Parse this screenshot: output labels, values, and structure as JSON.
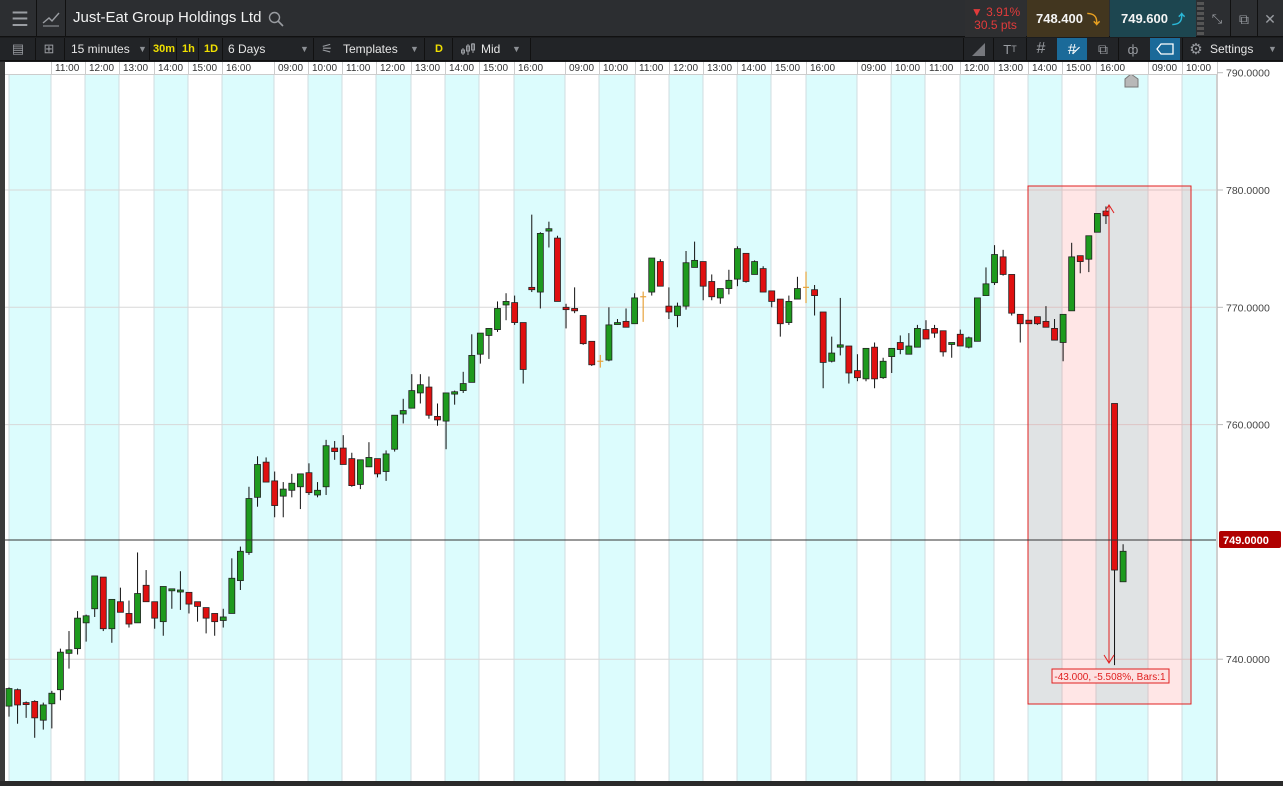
{
  "header": {
    "title": "Just-Eat Group Holdings Ltd",
    "change_pct": "▼ 3.91%",
    "change_pts": "30.5 pts",
    "sell_price": "748.400",
    "buy_price": "749.600"
  },
  "toolbar": {
    "interval": "15 minutes",
    "quick_intervals": [
      "30m",
      "1h",
      "1D"
    ],
    "range": "6 Days",
    "templates": "Templates",
    "d_label": "D",
    "price_type": "Mid",
    "settings": "Settings"
  },
  "time_axis": [
    "11:00",
    "12:00",
    "13:00",
    "14:00",
    "15:00",
    "16:00",
    "09:00",
    "10:00",
    "11:00",
    "12:00",
    "13:00",
    "14:00",
    "15:00",
    "16:00",
    "09:00",
    "10:00",
    "11:00",
    "12:00",
    "13:00",
    "14:00",
    "15:00",
    "16:00",
    "09:00",
    "10:00",
    "11:00",
    "12:00",
    "13:00",
    "14:00",
    "15:00",
    "16:00",
    "09:00",
    "10:00"
  ],
  "price_axis": {
    "ticks": [
      "790.0000",
      "780.0000",
      "770.0000",
      "760.0000",
      "740.0000"
    ],
    "current_price": "749.0000"
  },
  "measure": {
    "label": "-43.000, -5.508%, Bars:1"
  },
  "colors": {
    "up": "#1e9a1e",
    "down": "#e01010",
    "doji": "#e8a33d",
    "current": "#b00000",
    "measure": "#e02020"
  },
  "chart_data": {
    "type": "candlestick",
    "interval": "15 minutes",
    "ylim": [
      735,
      790
    ],
    "y_ticks": [
      790,
      780,
      770,
      760,
      740
    ],
    "current_price": 749.0,
    "doji_orange_indices": [
      69,
      74,
      93
    ],
    "ohlc": [
      [
        736.0,
        737.6,
        735.1,
        737.5
      ],
      [
        737.4,
        737.5,
        734.5,
        736.1
      ],
      [
        736.3,
        736.4,
        735.0,
        736.2
      ],
      [
        736.4,
        736.5,
        733.3,
        735.0
      ],
      [
        734.8,
        736.3,
        734.0,
        736.1
      ],
      [
        736.2,
        737.3,
        734.1,
        737.1
      ],
      [
        737.4,
        740.9,
        736.5,
        740.6
      ],
      [
        740.5,
        742.4,
        739.2,
        740.8
      ],
      [
        740.9,
        744.1,
        740.4,
        743.5
      ],
      [
        743.1,
        743.8,
        741.5,
        743.7
      ],
      [
        744.3,
        747.1,
        743.6,
        747.1
      ],
      [
        747.0,
        747.0,
        742.4,
        742.6
      ],
      [
        742.6,
        745.1,
        741.4,
        745.1
      ],
      [
        744.9,
        746.1,
        744.0,
        744.0
      ],
      [
        743.9,
        745.0,
        742.7,
        743.0
      ],
      [
        743.1,
        749.1,
        743.1,
        745.6
      ],
      [
        746.3,
        747.6,
        744.9,
        744.9
      ],
      [
        744.9,
        744.9,
        742.6,
        743.5
      ],
      [
        743.2,
        746.2,
        742.0,
        746.2
      ],
      [
        745.9,
        745.9,
        744.3,
        746.0
      ],
      [
        745.8,
        747.5,
        744.2,
        745.9
      ],
      [
        745.7,
        745.7,
        743.9,
        744.7
      ],
      [
        744.9,
        744.9,
        743.2,
        744.5
      ],
      [
        744.4,
        744.4,
        742.2,
        743.5
      ],
      [
        743.9,
        743.9,
        742.0,
        743.2
      ],
      [
        743.3,
        744.3,
        742.7,
        743.6
      ],
      [
        743.9,
        748.6,
        743.9,
        746.9
      ],
      [
        746.7,
        749.6,
        745.9,
        749.2
      ],
      [
        749.1,
        754.7,
        748.9,
        753.7
      ],
      [
        753.8,
        757.3,
        753.0,
        756.6
      ],
      [
        756.8,
        757.2,
        755.1,
        755.1
      ],
      [
        755.2,
        756.0,
        752.1,
        753.1
      ],
      [
        753.9,
        755.1,
        752.1,
        754.5
      ],
      [
        754.4,
        755.8,
        753.8,
        755.0
      ],
      [
        754.7,
        755.8,
        752.8,
        755.8
      ],
      [
        755.9,
        756.7,
        754.0,
        754.2
      ],
      [
        754.0,
        755.1,
        753.8,
        754.4
      ],
      [
        754.7,
        758.7,
        754.0,
        758.2
      ],
      [
        758.0,
        758.6,
        757.0,
        757.7
      ],
      [
        758.0,
        759.1,
        756.6,
        756.6
      ],
      [
        757.1,
        757.6,
        754.7,
        754.8
      ],
      [
        754.9,
        757.0,
        754.5,
        757.0
      ],
      [
        756.4,
        758.5,
        756.4,
        757.2
      ],
      [
        757.1,
        757.1,
        755.5,
        755.8
      ],
      [
        756.0,
        757.8,
        755.2,
        757.5
      ],
      [
        757.9,
        760.8,
        757.7,
        760.8
      ],
      [
        760.9,
        762.2,
        760.1,
        761.2
      ],
      [
        761.4,
        764.3,
        761.4,
        762.9
      ],
      [
        762.7,
        764.3,
        761.8,
        763.4
      ],
      [
        763.2,
        764.1,
        760.5,
        760.8
      ],
      [
        760.7,
        761.8,
        759.9,
        760.4
      ],
      [
        760.3,
        762.7,
        757.9,
        762.7
      ],
      [
        762.6,
        762.9,
        761.7,
        762.8
      ],
      [
        762.9,
        764.5,
        762.7,
        763.5
      ],
      [
        763.6,
        767.7,
        763.6,
        765.9
      ],
      [
        766.0,
        767.8,
        765.2,
        767.8
      ],
      [
        767.6,
        768.2,
        765.6,
        768.2
      ],
      [
        768.1,
        770.5,
        767.9,
        769.9
      ],
      [
        770.2,
        771.2,
        768.9,
        770.5
      ],
      [
        770.4,
        771.0,
        768.5,
        768.7
      ],
      [
        768.7,
        768.7,
        763.5,
        764.7
      ],
      [
        771.7,
        777.9,
        771.3,
        771.5
      ],
      [
        771.3,
        776.4,
        769.9,
        776.3
      ],
      [
        776.5,
        777.3,
        775.1,
        776.7
      ],
      [
        775.9,
        776.1,
        770.5,
        770.5
      ],
      [
        770.0,
        770.3,
        768.2,
        769.8
      ],
      [
        769.9,
        771.7,
        769.5,
        769.7
      ],
      [
        769.3,
        769.3,
        766.8,
        766.9
      ],
      [
        767.1,
        767.1,
        765.0,
        765.1
      ],
      [
        765.4,
        765.6,
        765.2,
        765.4
      ],
      [
        765.5,
        770.0,
        765.4,
        768.5
      ],
      [
        768.6,
        769.0,
        768.6,
        768.7
      ],
      [
        768.8,
        769.9,
        768.3,
        768.3
      ],
      [
        768.6,
        771.2,
        768.6,
        770.8
      ],
      [
        770.9,
        771.0,
        769.1,
        770.9
      ],
      [
        771.3,
        774.2,
        771.0,
        774.2
      ],
      [
        773.9,
        774.1,
        771.8,
        771.8
      ],
      [
        770.1,
        771.7,
        769.0,
        769.6
      ],
      [
        769.3,
        770.4,
        768.3,
        770.1
      ],
      [
        770.1,
        774.8,
        769.8,
        773.8
      ],
      [
        773.4,
        775.6,
        773.4,
        774.0
      ],
      [
        773.9,
        773.9,
        770.6,
        771.8
      ],
      [
        772.2,
        772.8,
        770.6,
        770.9
      ],
      [
        770.8,
        771.6,
        770.3,
        771.6
      ],
      [
        771.6,
        773.2,
        771.1,
        772.3
      ],
      [
        772.4,
        775.2,
        771.8,
        775.0
      ],
      [
        774.6,
        774.6,
        772.1,
        772.2
      ],
      [
        772.8,
        774.0,
        772.8,
        773.9
      ],
      [
        773.3,
        773.5,
        771.3,
        771.3
      ],
      [
        771.4,
        771.4,
        770.0,
        770.5
      ],
      [
        770.7,
        770.7,
        767.5,
        768.6
      ],
      [
        768.7,
        771.0,
        768.5,
        770.5
      ],
      [
        770.7,
        772.6,
        770.7,
        771.6
      ],
      [
        771.7,
        772.7,
        770.7,
        771.7
      ],
      [
        771.5,
        771.9,
        769.3,
        771.0
      ],
      [
        769.6,
        769.6,
        763.1,
        765.3
      ],
      [
        765.4,
        767.5,
        765.3,
        766.1
      ],
      [
        766.6,
        770.8,
        765.9,
        766.8
      ],
      [
        766.7,
        766.7,
        763.5,
        764.4
      ],
      [
        764.6,
        766.0,
        763.7,
        764.0
      ],
      [
        763.9,
        766.5,
        763.7,
        766.5
      ],
      [
        766.6,
        767.0,
        763.1,
        763.9
      ],
      [
        764.0,
        765.7,
        763.9,
        765.4
      ],
      [
        765.8,
        766.5,
        764.4,
        766.5
      ],
      [
        767.0,
        767.6,
        766.0,
        766.4
      ],
      [
        766.0,
        767.8,
        766.0,
        766.7
      ],
      [
        766.6,
        768.5,
        766.6,
        768.2
      ],
      [
        768.1,
        768.9,
        767.3,
        767.3
      ],
      [
        768.2,
        768.5,
        767.4,
        767.8
      ],
      [
        768.0,
        768.0,
        765.8,
        766.2
      ],
      [
        767.0,
        767.0,
        765.7,
        767.0
      ],
      [
        767.7,
        768.1,
        766.7,
        766.7
      ],
      [
        766.6,
        767.5,
        766.5,
        767.4
      ],
      [
        767.1,
        770.8,
        767.1,
        770.8
      ],
      [
        771.0,
        773.4,
        771.0,
        772.0
      ],
      [
        772.1,
        775.3,
        771.9,
        774.5
      ],
      [
        774.3,
        774.9,
        772.7,
        772.8
      ],
      [
        772.8,
        772.8,
        769.3,
        769.5
      ],
      [
        769.4,
        769.4,
        767.0,
        768.6
      ],
      [
        768.9,
        768.9,
        768.6,
        768.6
      ],
      [
        769.2,
        769.2,
        768.5,
        768.6
      ],
      [
        768.8,
        770.1,
        768.3,
        768.3
      ],
      [
        768.2,
        769.0,
        767.2,
        767.2
      ],
      [
        767.0,
        769.4,
        765.4,
        769.4
      ],
      [
        769.7,
        775.5,
        769.7,
        774.3
      ],
      [
        774.4,
        774.4,
        772.9,
        773.9
      ],
      [
        774.1,
        776.1,
        773.0,
        776.1
      ],
      [
        776.4,
        778.0,
        776.4,
        778.0
      ],
      [
        778.2,
        778.6,
        777.1,
        777.8
      ],
      [
        761.8,
        761.8,
        739.5,
        747.6
      ],
      [
        746.6,
        749.8,
        746.6,
        749.2
      ]
    ],
    "measurement": {
      "from": 782.6,
      "to": 739.6,
      "change": -43.0,
      "change_pct": -5.508,
      "bars": 1
    }
  }
}
